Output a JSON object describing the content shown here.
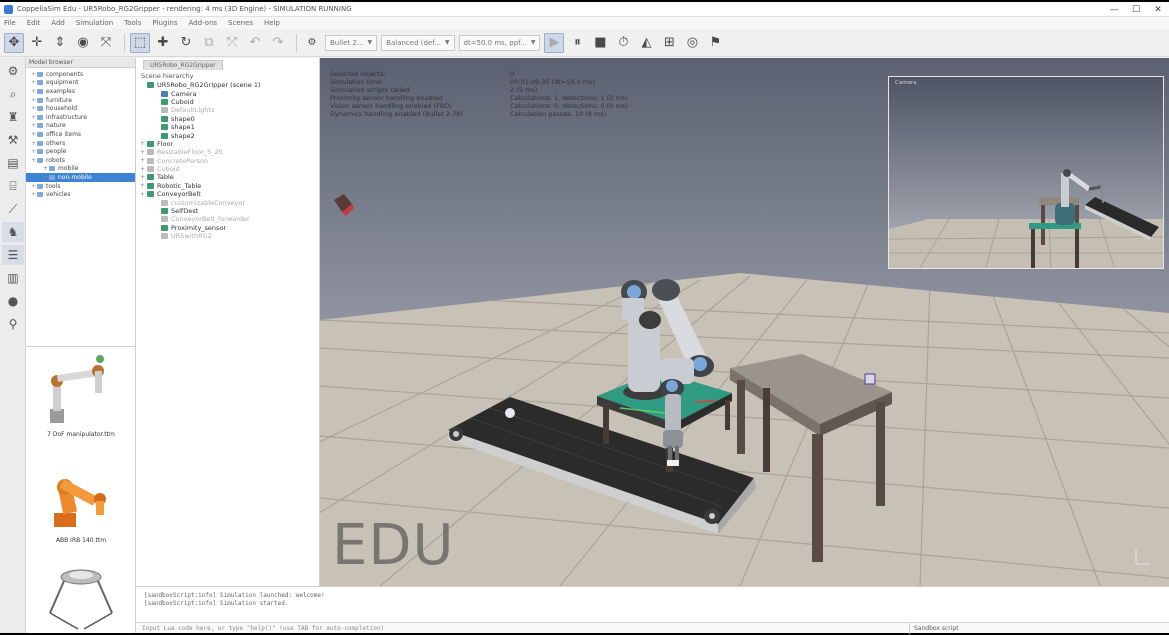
{
  "window": {
    "title": "CoppeliaSim Edu - UR5Robo_RG2Gripper - rendering: 4 ms (3D Engine) - SIMULATION RUNNING",
    "controls": [
      "—",
      "☐",
      "✕"
    ]
  },
  "menu": [
    "File",
    "Edit",
    "Add",
    "Simulation",
    "Tools",
    "Plugins",
    "Add-ons",
    "Scenes",
    "Help"
  ],
  "toolbar": {
    "engine": "Bullet 2...",
    "accuracy": "Balanced (def...",
    "timestep": "dt=50.0 ms, ppf..."
  },
  "model_browser": {
    "header": "Model browser",
    "items": [
      {
        "label": "components",
        "level": 0
      },
      {
        "label": "equipment",
        "level": 0
      },
      {
        "label": "examples",
        "level": 0
      },
      {
        "label": "furniture",
        "level": 0
      },
      {
        "label": "household",
        "level": 0
      },
      {
        "label": "infrastructure",
        "level": 0
      },
      {
        "label": "nature",
        "level": 0
      },
      {
        "label": "office items",
        "level": 0
      },
      {
        "label": "others",
        "level": 0
      },
      {
        "label": "people",
        "level": 0
      },
      {
        "label": "robots",
        "level": 0
      },
      {
        "label": "mobile",
        "level": 1
      },
      {
        "label": "non-mobile",
        "level": 1,
        "selected": true
      },
      {
        "label": "tools",
        "level": 0
      },
      {
        "label": "vehicles",
        "level": 0
      }
    ],
    "thumbnails": [
      {
        "caption": "7 DoF manipulator.ttm"
      },
      {
        "caption": "ABB IRB 140.ttm"
      },
      {
        "caption": ""
      }
    ]
  },
  "scene": {
    "tab": "UR5Robo_RG2Gripper",
    "header": "Scene hierarchy",
    "items": [
      {
        "label": "UR5Robo_RG2Gripper (scene 1)",
        "level": 0,
        "icon": "scene"
      },
      {
        "label": "Camera",
        "level": 1,
        "icon": "cam"
      },
      {
        "label": "Cuboid",
        "level": 1,
        "icon": "shape"
      },
      {
        "label": "DefaultLights",
        "level": 1,
        "icon": "grey",
        "dim": true
      },
      {
        "label": "shape0",
        "level": 1,
        "icon": "shape"
      },
      {
        "label": "shape1",
        "level": 1,
        "icon": "shape"
      },
      {
        "label": "shape2",
        "level": 1,
        "icon": "shape"
      },
      {
        "label": "Floor",
        "level": 0,
        "icon": "shape"
      },
      {
        "label": "ResizableFloor_5_25",
        "level": 0,
        "icon": "grey",
        "dim": true
      },
      {
        "label": "ConcretePerson",
        "level": 0,
        "icon": "grey",
        "dim": true
      },
      {
        "label": "Cuboid",
        "level": 0,
        "icon": "grey",
        "dim": true
      },
      {
        "label": "Table",
        "level": 0,
        "icon": "shape"
      },
      {
        "label": "Robotic_Table",
        "level": 0,
        "icon": "shape"
      },
      {
        "label": "ConveyorBelt",
        "level": 0,
        "icon": "shape"
      },
      {
        "label": "customizableConveyor",
        "level": 1,
        "icon": "grey",
        "dim": true
      },
      {
        "label": "SelfDest",
        "level": 1,
        "icon": "shape"
      },
      {
        "label": "ConveyorBelt_forwarder",
        "level": 1,
        "icon": "grey",
        "dim": true
      },
      {
        "label": "Proximity_sensor",
        "level": 1,
        "icon": "shape"
      },
      {
        "label": "UR5withRG2",
        "level": 1,
        "icon": "grey",
        "dim": true
      }
    ]
  },
  "info": [
    {
      "label": "Selected objects:",
      "value": "0"
    },
    {
      "label": "Simulation time:",
      "value": "00:01:09.35 (dt=50.0 ms)"
    },
    {
      "label": "Simulation scripts called:",
      "value": "2 (5 ms)"
    },
    {
      "label": "Proximity sensor handling enabled",
      "value": "Calculations: 1, detections: 1 (0 ms)"
    },
    {
      "label": "Vision sensor handling enabled (FBO)",
      "value": "Calculations: 0, detections: 0 (0 ms)"
    },
    {
      "label": "Dynamics handling enabled (Bullet 2.78)",
      "value": "Calculation passes: 10 (8 ms)"
    }
  ],
  "viewport": {
    "watermark": "EDU",
    "pip_label": "Camera"
  },
  "console": {
    "lines": [
      "[sandboxScript:info] Simulation launched: welcome!",
      "[sandboxScript:info] Simulation started."
    ],
    "input_placeholder": "Input Lua code here, or type \"help()\" (use TAB for auto-completion)",
    "script_select": "Sandbox script"
  },
  "colors": {
    "floor_light": "#c9c3b8",
    "floor_dark": "#aca59a",
    "sky_top": "#5b6170",
    "sky_bottom": "#c5c9d2",
    "selection": "#3d84d6",
    "table_top": "#9b948a",
    "table_leg": "#5a4a45",
    "robot_table": "#2f9b82",
    "belt": "#2a2a2a"
  }
}
